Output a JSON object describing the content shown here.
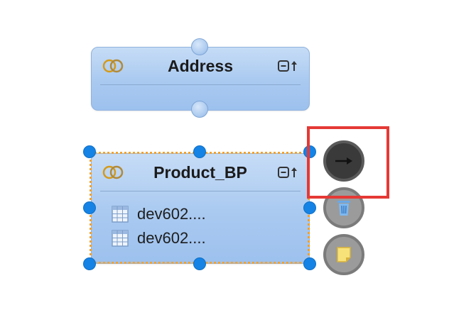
{
  "nodes": {
    "address": {
      "title": "Address",
      "join_icon": "join-rings-icon",
      "collapse_icon": "collapse-icon"
    },
    "product_bp": {
      "title": "Product_BP",
      "join_icon": "join-rings-icon",
      "collapse_icon": "collapse-icon",
      "rows": [
        {
          "icon": "table-icon",
          "label": "dev602...."
        },
        {
          "icon": "table-icon",
          "label": "dev602...."
        }
      ]
    }
  },
  "actions": [
    {
      "name": "connect-arrow",
      "icon": "arrow-right-icon"
    },
    {
      "name": "delete",
      "icon": "trash-icon"
    },
    {
      "name": "note",
      "icon": "note-icon"
    }
  ],
  "colors": {
    "node_fill": "#a9c9f0",
    "selection_border": "#f2a12e",
    "selection_handle": "#1583e6",
    "highlight_box": "#e53935",
    "action_dark": "#3a3a3a",
    "action_grey": "#9b9b9b"
  }
}
